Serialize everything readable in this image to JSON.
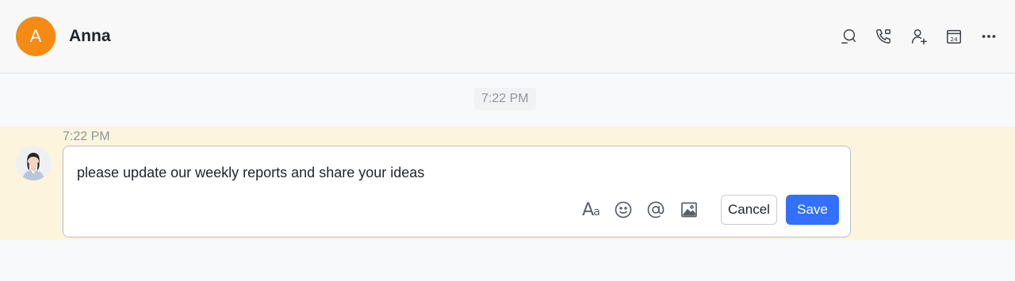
{
  "header": {
    "avatar_letter": "A",
    "title": "Anna",
    "icons": [
      "search-chat-icon",
      "call-icon",
      "add-member-icon",
      "calendar-icon",
      "more-icon"
    ],
    "calendar_day": "24"
  },
  "divider": {
    "time": "7:22 PM"
  },
  "message": {
    "time": "7:22 PM",
    "editor_text": "please update our weekly reports and share your ideas",
    "toolbar": {
      "format_label": "Aa",
      "icons": [
        "text-format-icon",
        "emoji-icon",
        "mention-icon",
        "image-icon"
      ]
    },
    "cancel_label": "Cancel",
    "save_label": "Save"
  },
  "colors": {
    "accent": "#3370ff",
    "avatar": "#f58a14",
    "highlight_row": "#fcf4dc"
  }
}
